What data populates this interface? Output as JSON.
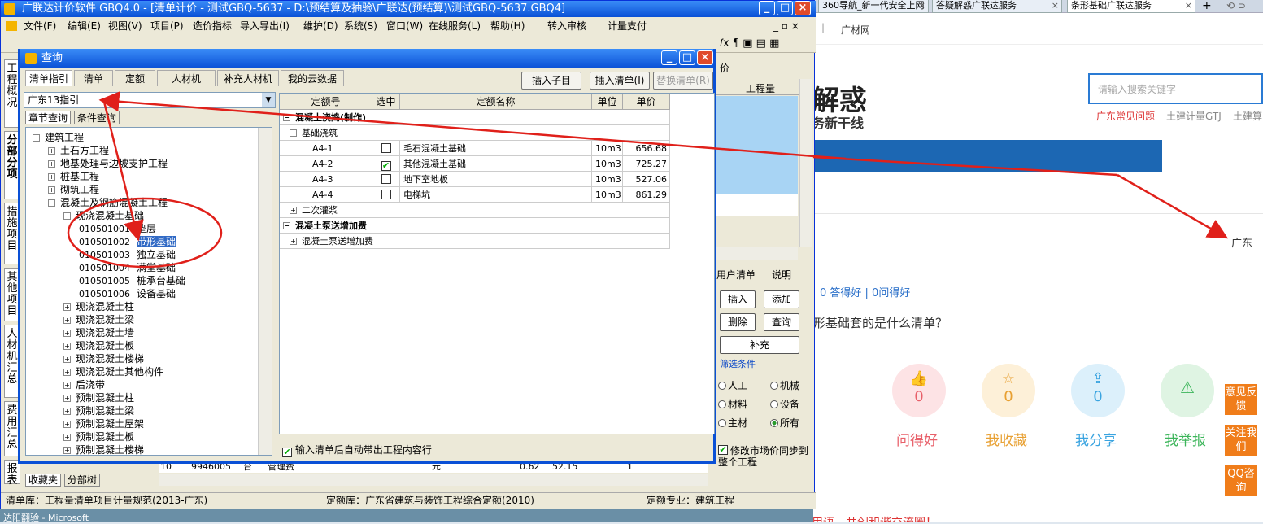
{
  "browser": {
    "tabs": [
      {
        "label": "360导航_新一代安全上网",
        "active": false
      },
      {
        "label": "答疑解惑广联达服务",
        "active": false
      },
      {
        "label": "条形基础广联达服务",
        "active": true
      }
    ],
    "tab_new": "+",
    "links": [
      "广材网"
    ],
    "headline": "解惑",
    "subheadline": "务新干线",
    "search_placeholder": "请输入搜索关键字",
    "category_links": [
      "广东常见问题",
      "土建计量GTJ",
      "土建算"
    ],
    "region_label": "广东",
    "answer_stats": "0 答得好 | 0问得好",
    "question_text": "形基础套的是什么清单？",
    "actions": [
      {
        "label": "问得好",
        "count": "0",
        "color": "#e8606a",
        "bg": "#fde3e5"
      },
      {
        "label": "我收藏",
        "count": "0",
        "color": "#e8a032",
        "bg": "#fdf0d8"
      },
      {
        "label": "我分享",
        "count": "0",
        "color": "#3aa4e0",
        "bg": "#dcf0fb"
      },
      {
        "label": "我举报",
        "count": "",
        "color": "#3cb55a",
        "bg": "#dff4e3"
      }
    ],
    "float_buttons": [
      "意见反馈",
      "关注我们",
      "QQ咨询"
    ],
    "footer_text": "文明用语，共创和谐交流圈！"
  },
  "app": {
    "title": "广联达计价软件 GBQ4.0 - [清单计价 - 测试GBQ-5637 - D:\\预结算及抽验\\广联达(预结算)\\测试GBQ-5637.GBQ4]",
    "menus": [
      "文件(F)",
      "编辑(E)",
      "视图(V)",
      "项目(P)",
      "造价指标",
      "导入导出(I)",
      "维护(D)",
      "系统(S)",
      "窗口(W)",
      "在线服务(L)",
      "帮助(H)",
      "转入审核",
      "计量支付"
    ],
    "vtabs": [
      "工程概况",
      "分部分项",
      "措施项目",
      "其他项目",
      "人材机汇总",
      "费用汇总",
      "报表"
    ],
    "right_col_header": "工程量",
    "right_col_header2": "价",
    "right_tabs": [
      "用户清单",
      "说明"
    ],
    "right_buttons": [
      "插入",
      "添加",
      "删除",
      "查询",
      "补充"
    ],
    "filter_title": "筛选条件",
    "filters": [
      {
        "label": "人工",
        "checked": false
      },
      {
        "label": "机械",
        "checked": false
      },
      {
        "label": "材料",
        "checked": false
      },
      {
        "label": "设备",
        "checked": false
      },
      {
        "label": "主材",
        "checked": false
      },
      {
        "label": "所有",
        "checked": true
      }
    ],
    "sync_checkbox": "修改市场价同步到整个工程",
    "bottom_row": [
      "10",
      "9946005",
      "台",
      "管理费",
      "元",
      "0.62",
      "52.15",
      "1"
    ],
    "bottom_tabs": [
      "收藏夹",
      "分部树"
    ],
    "status": {
      "list_lib": "清单库：工程量清单项目计量规范(2013-广东)",
      "quota_lib": "定额库：广东省建筑与装饰工程综合定额(2010)",
      "specialty": "定额专业：建筑工程"
    },
    "taskbar_text": "达阳翻验 - Microsoft"
  },
  "dialog": {
    "title": "查询",
    "tabs": [
      "清单指引",
      "清单",
      "定额",
      "人材机",
      "补充人材机",
      "我的云数据"
    ],
    "buttons": [
      {
        "label": "插入子目",
        "enabled": true
      },
      {
        "label": "插入清单(I)",
        "enabled": true
      },
      {
        "label": "替换清单(R)",
        "enabled": false
      }
    ],
    "guide_select": "广东13指引",
    "sub_tabs": [
      "章节查询",
      "条件查询"
    ],
    "tree": [
      {
        "level": 0,
        "toggle": "−",
        "code": "",
        "label": "建筑工程"
      },
      {
        "level": 1,
        "toggle": "+",
        "code": "",
        "label": "土石方工程"
      },
      {
        "level": 1,
        "toggle": "+",
        "code": "",
        "label": "地基处理与边坡支护工程"
      },
      {
        "level": 1,
        "toggle": "+",
        "code": "",
        "label": "桩基工程"
      },
      {
        "level": 1,
        "toggle": "+",
        "code": "",
        "label": "砌筑工程"
      },
      {
        "level": 1,
        "toggle": "−",
        "code": "",
        "label": "混凝土及钢筋混凝土工程"
      },
      {
        "level": 2,
        "toggle": "−",
        "code": "",
        "label": "现浇混凝土基础"
      },
      {
        "level": 3,
        "toggle": "",
        "code": "010501001",
        "label": "垫层"
      },
      {
        "level": 3,
        "toggle": "",
        "code": "010501002",
        "label": "带形基础",
        "selected": true
      },
      {
        "level": 3,
        "toggle": "",
        "code": "010501003",
        "label": "独立基础"
      },
      {
        "level": 3,
        "toggle": "",
        "code": "010501004",
        "label": "满堂基础"
      },
      {
        "level": 3,
        "toggle": "",
        "code": "010501005",
        "label": "桩承台基础"
      },
      {
        "level": 3,
        "toggle": "",
        "code": "010501006",
        "label": "设备基础"
      },
      {
        "level": 2,
        "toggle": "+",
        "code": "",
        "label": "现浇混凝土柱"
      },
      {
        "level": 2,
        "toggle": "+",
        "code": "",
        "label": "现浇混凝土梁"
      },
      {
        "level": 2,
        "toggle": "+",
        "code": "",
        "label": "现浇混凝土墙"
      },
      {
        "level": 2,
        "toggle": "+",
        "code": "",
        "label": "现浇混凝土板"
      },
      {
        "level": 2,
        "toggle": "+",
        "code": "",
        "label": "现浇混凝土楼梯"
      },
      {
        "level": 2,
        "toggle": "+",
        "code": "",
        "label": "现浇混凝土其他构件"
      },
      {
        "level": 2,
        "toggle": "+",
        "code": "",
        "label": "后浇带"
      },
      {
        "level": 2,
        "toggle": "+",
        "code": "",
        "label": "预制混凝土柱"
      },
      {
        "level": 2,
        "toggle": "+",
        "code": "",
        "label": "预制混凝土梁"
      },
      {
        "level": 2,
        "toggle": "+",
        "code": "",
        "label": "预制混凝土屋架"
      },
      {
        "level": 2,
        "toggle": "+",
        "code": "",
        "label": "预制混凝土板"
      },
      {
        "level": 2,
        "toggle": "+",
        "code": "",
        "label": "预制混凝土楼梯"
      }
    ],
    "grid_headers": [
      "定额号",
      "选中",
      "定额名称",
      "单位",
      "单价"
    ],
    "grid_rows": [
      {
        "type": "group",
        "toggle": "−",
        "label": "混凝土浇捣(制作)"
      },
      {
        "type": "sub",
        "toggle": "−",
        "label": "基础浇筑"
      },
      {
        "type": "item",
        "code": "A4-1",
        "checked": false,
        "name": "毛石混凝土基础",
        "unit": "10m3",
        "price": "656.68"
      },
      {
        "type": "item",
        "code": "A4-2",
        "checked": true,
        "name": "其他混凝土基础",
        "unit": "10m3",
        "price": "725.27"
      },
      {
        "type": "item",
        "code": "A4-3",
        "checked": false,
        "name": "地下室地板",
        "unit": "10m3",
        "price": "527.06"
      },
      {
        "type": "item",
        "code": "A4-4",
        "checked": false,
        "name": "电梯坑",
        "unit": "10m3",
        "price": "861.29"
      },
      {
        "type": "sub",
        "toggle": "+",
        "label": "二次灌浆"
      },
      {
        "type": "group",
        "toggle": "−",
        "label": "混凝土泵送增加费"
      },
      {
        "type": "sub",
        "toggle": "+",
        "label": "混凝土泵送增加费"
      }
    ],
    "auto_checkbox": "输入清单后自动带出工程内容行"
  },
  "colors": {
    "annotation": "#e0201a",
    "xp_blue": "#0a50d6",
    "selection": "#316ac5"
  }
}
